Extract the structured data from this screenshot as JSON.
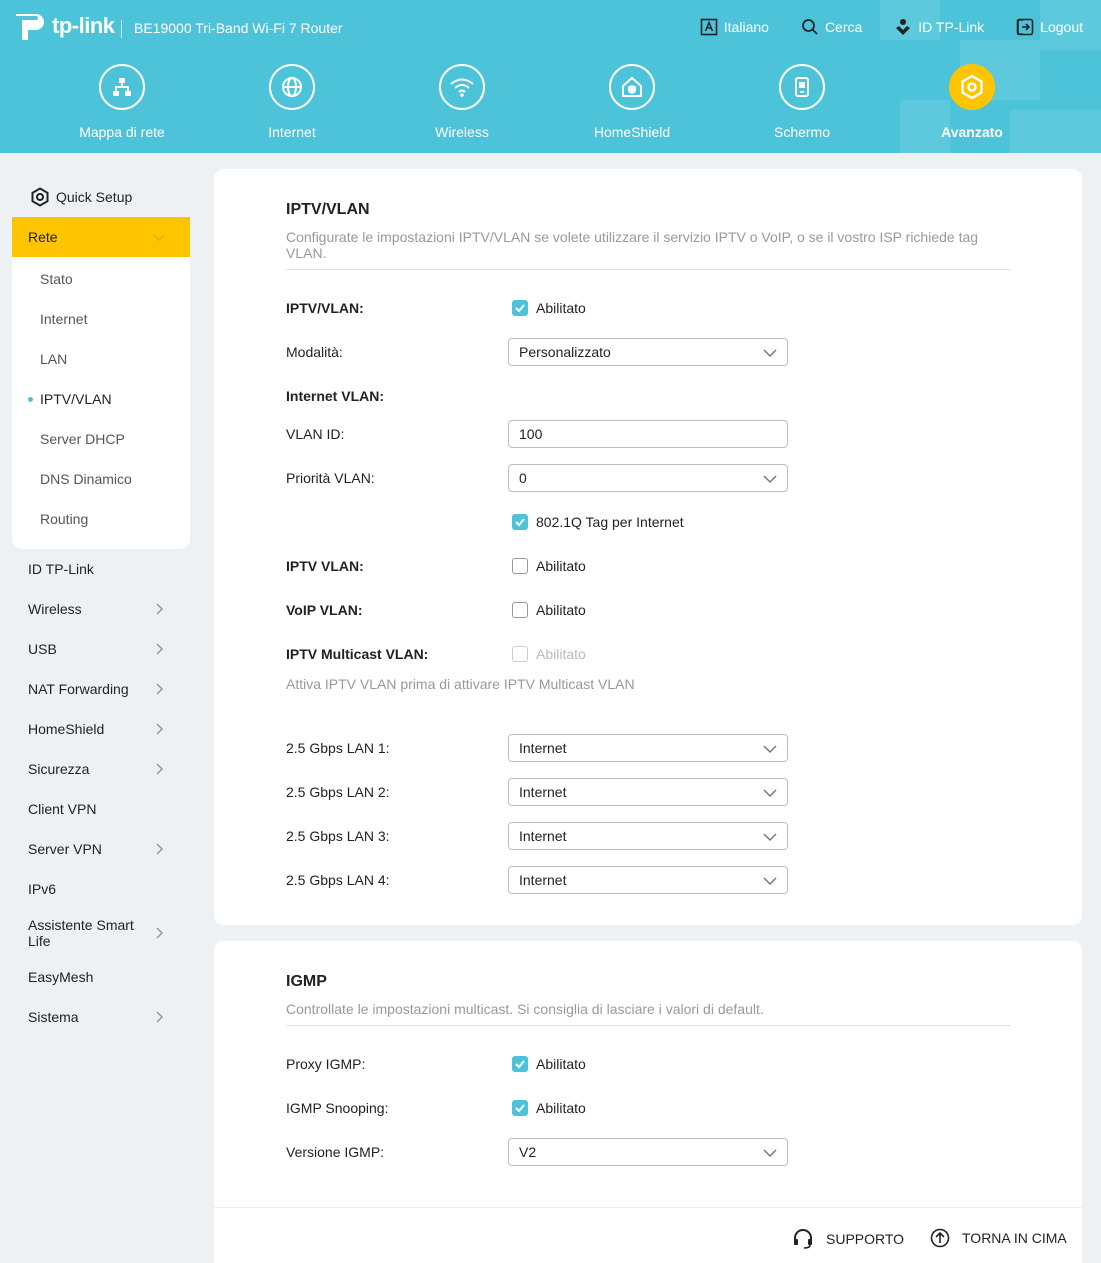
{
  "header": {
    "brand": "tp-link",
    "model": "BE19000 Tri-Band Wi-Fi 7 Router",
    "links": [
      {
        "label": "Italiano",
        "icon": "language-icon"
      },
      {
        "label": "Cerca",
        "icon": "search-icon"
      },
      {
        "label": "ID TP-Link",
        "icon": "tplink-id-icon"
      },
      {
        "label": "Logout",
        "icon": "logout-icon"
      }
    ],
    "tabs": [
      {
        "label": "Mappa di rete",
        "icon": "network-map-icon"
      },
      {
        "label": "Internet",
        "icon": "globe-icon"
      },
      {
        "label": "Wireless",
        "icon": "wifi-icon"
      },
      {
        "label": "HomeShield",
        "icon": "homeshield-icon"
      },
      {
        "label": "Schermo",
        "icon": "screen-icon"
      },
      {
        "label": "Avanzato",
        "icon": "gear-icon",
        "active": true
      }
    ],
    "accent": "#4cc3d9",
    "active_color": "#ffc400"
  },
  "sidebar": {
    "quick_setup": "Quick Setup",
    "section": "Rete",
    "sub_items": [
      "Stato",
      "Internet",
      "LAN",
      "IPTV/VLAN",
      "Server DHCP",
      "DNS Dinamico",
      "Routing"
    ],
    "active_sub": "IPTV/VLAN",
    "items": [
      "ID TP-Link",
      "Wireless",
      "USB",
      "NAT Forwarding",
      "HomeShield",
      "Sicurezza",
      "Client VPN",
      "Server VPN",
      "IPv6",
      "Assistente Smart Life",
      "EasyMesh",
      "Sistema"
    ]
  },
  "iptv": {
    "title": "IPTV/VLAN",
    "desc": "Configurate le impostazioni IPTV/VLAN se volete utilizzare il servizio IPTV o VoIP, o se il vostro ISP richiede tag VLAN.",
    "iptv_vlan_label": "IPTV/VLAN:",
    "iptv_vlan_value": "Abilitato",
    "mode_label": "Modalità:",
    "mode_value": "Personalizzato",
    "internet_vlan_label": "Internet VLAN:",
    "vlan_id_label": "VLAN ID:",
    "vlan_id_value": "100",
    "vlan_priority_label": "Priorità VLAN:",
    "vlan_priority_value": "0",
    "tag_label": "802.1Q Tag per Internet",
    "iptv_vlan2_label": "IPTV VLAN:",
    "iptv_vlan2_value": "Abilitato",
    "voip_label": "VoIP VLAN:",
    "voip_value": "Abilitato",
    "multicast_label": "IPTV Multicast VLAN:",
    "multicast_value": "Abilitato",
    "multicast_hint": "Attiva IPTV VLAN prima di attivare IPTV Multicast VLAN",
    "lan1_label": "2.5 Gbps LAN 1:",
    "lan1_value": "Internet",
    "lan2_label": "2.5 Gbps LAN 2:",
    "lan2_value": "Internet",
    "lan3_label": "2.5 Gbps LAN 3:",
    "lan3_value": "Internet",
    "lan4_label": "2.5 Gbps LAN 4:",
    "lan4_value": "Internet"
  },
  "igmp": {
    "title": "IGMP",
    "desc": "Controllate le impostazioni multicast. Si consiglia di lasciare i valori di default.",
    "proxy_label": "Proxy IGMP:",
    "proxy_value": "Abilitato",
    "snooping_label": "IGMP Snooping:",
    "snooping_value": "Abilitato",
    "version_label": "Versione IGMP:",
    "version_value": "V2"
  },
  "footer": {
    "support": "SUPPORTO",
    "top": "TORNA IN CIMA"
  }
}
